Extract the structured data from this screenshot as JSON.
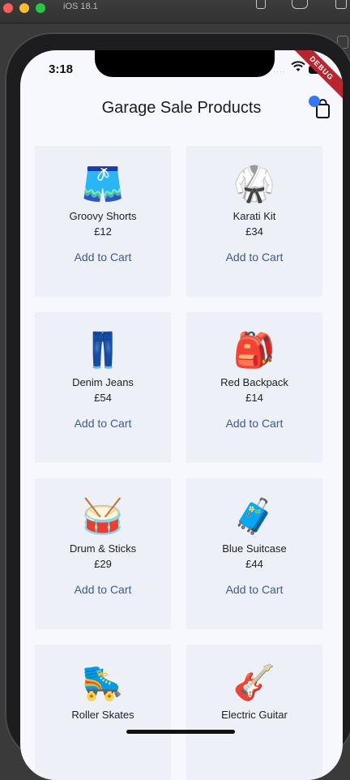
{
  "simulator": {
    "title": "iOS 18.1"
  },
  "status_bar": {
    "time": "3:18",
    "debug_label": "DEBUG"
  },
  "app": {
    "title": "Garage Sale Products",
    "cart_icon": "shopping-bag-icon"
  },
  "products": [
    {
      "icon": "🩳",
      "name": "Groovy Shorts",
      "price": "£12",
      "action": "Add to Cart"
    },
    {
      "icon": "🥋",
      "name": "Karati Kit",
      "price": "£34",
      "action": "Add to Cart"
    },
    {
      "icon": "👖",
      "name": "Denim Jeans",
      "price": "£54",
      "action": "Add to Cart"
    },
    {
      "icon": "🎒",
      "name": "Red Backpack",
      "price": "£14",
      "action": "Add to Cart"
    },
    {
      "icon": "🥁",
      "name": "Drum & Sticks",
      "price": "£29",
      "action": "Add to Cart"
    },
    {
      "icon": "🧳",
      "name": "Blue Suitcase",
      "price": "£44",
      "action": "Add to Cart"
    },
    {
      "icon": "🛼",
      "name": "Roller Skates",
      "price": "",
      "action": ""
    },
    {
      "icon": "🎸",
      "name": "Electric Guitar",
      "price": "",
      "action": ""
    }
  ],
  "colors": {
    "background": "#f7f8fd",
    "card": "#eef0f8",
    "accent": "#3378f6",
    "action_text": "#3f5a8c"
  }
}
